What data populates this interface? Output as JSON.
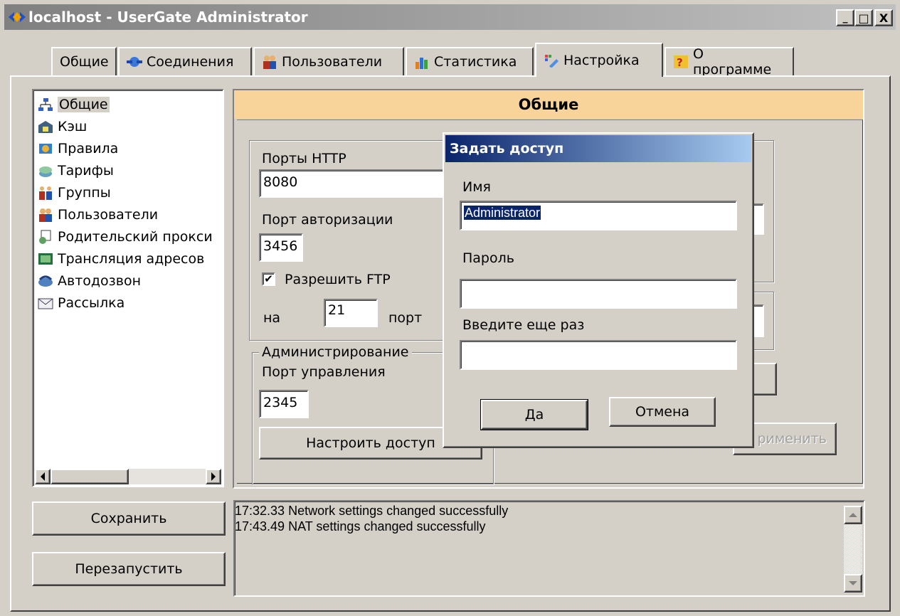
{
  "window": {
    "title": "localhost - UserGate Administrator",
    "controls": {
      "minimize": "_",
      "maximize": "□",
      "close": "X"
    }
  },
  "tabs": [
    {
      "label": "Общие",
      "icon": "none"
    },
    {
      "label": "Соединения",
      "icon": "connection-icon"
    },
    {
      "label": "Пользователи",
      "icon": "users-icon"
    },
    {
      "label": "Статистика",
      "icon": "stats-icon"
    },
    {
      "label": "Настройка",
      "icon": "settings-icon",
      "active": true
    },
    {
      "label": "О программе",
      "icon": "help-icon"
    }
  ],
  "tree": {
    "items": [
      {
        "label": "Общие",
        "icon": "network-icon",
        "selected": true
      },
      {
        "label": "Кэш",
        "icon": "cache-icon"
      },
      {
        "label": "Правила",
        "icon": "rules-icon"
      },
      {
        "label": "Тарифы",
        "icon": "tariff-icon"
      },
      {
        "label": "Группы",
        "icon": "groups-icon"
      },
      {
        "label": "Пользователи",
        "icon": "users-icon"
      },
      {
        "label": "Родительский прокси",
        "icon": "proxy-icon"
      },
      {
        "label": "Трансляция адресов",
        "icon": "nat-icon"
      },
      {
        "label": "Автодозвон",
        "icon": "dialer-icon"
      },
      {
        "label": "Рассылка",
        "icon": "mail-icon"
      }
    ]
  },
  "panel": {
    "header": "Общие",
    "http_ports_label": "Порты HTTP",
    "http_ports_value": "8080",
    "auth_port_label": "Порт авторизации",
    "auth_port_value": "3456",
    "allow_ftp_label": "Разрешить FTP",
    "allow_ftp_checked": true,
    "on_label": "на",
    "ftp_port_value": "21",
    "port_label": "порт",
    "admin_group_label": "Администрирование",
    "mgmt_port_label": "Порт управления",
    "mgmt_port_value": "2345",
    "configure_access_button": "Настроить доступ",
    "apply_button_partial": "рименить"
  },
  "dialog": {
    "title": "Задать доступ",
    "name_label": "Имя",
    "name_value": "Administrator",
    "password_label": "Пароль",
    "password_value": "",
    "repeat_label": "Введите еще раз",
    "repeat_value": "",
    "ok_button": "Да",
    "cancel_button": "Отмена"
  },
  "bottom": {
    "save_button": "Сохранить",
    "restart_button": "Перезапустить",
    "log_lines": [
      "17:32.33 Network settings changed successfully",
      "17:43.49 NAT settings changed successfully"
    ]
  },
  "colors": {
    "title_gradient_start": "#808080",
    "title_gradient_end": "#c0c0c0",
    "dialog_title_start": "#0a246a",
    "dialog_title_end": "#a6caf0",
    "panel_header": "#f9d49a",
    "selection": "#0a246a"
  }
}
